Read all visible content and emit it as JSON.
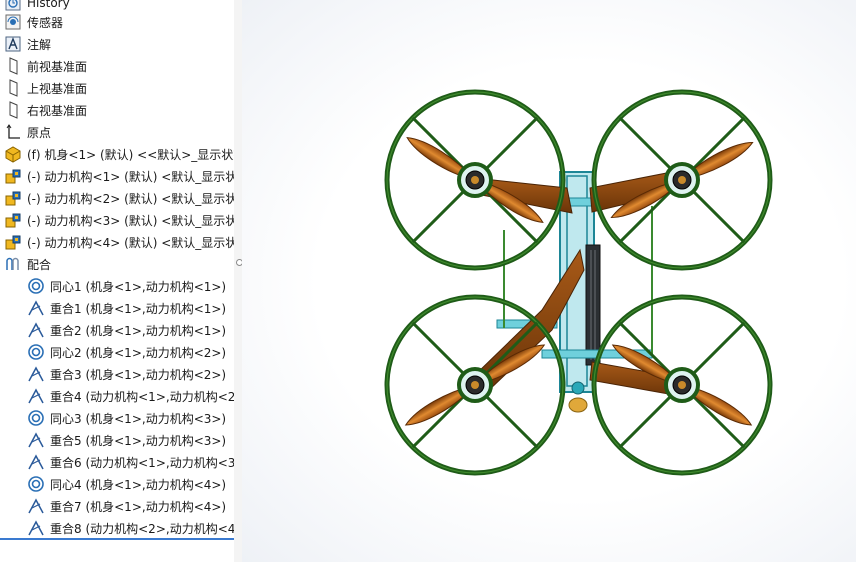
{
  "feature_tree": {
    "items": [
      {
        "label": "History",
        "icon": "history-icon"
      },
      {
        "label": "传感器",
        "icon": "sensor-icon"
      },
      {
        "label": "注解",
        "icon": "annotation-icon"
      },
      {
        "label": "前视基准面",
        "icon": "plane-icon"
      },
      {
        "label": "上视基准面",
        "icon": "plane-icon"
      },
      {
        "label": "右视基准面",
        "icon": "plane-icon"
      },
      {
        "label": "原点",
        "icon": "origin-icon"
      },
      {
        "label": "(f) 机身<1> (默认) <<默认>_显示状态",
        "icon": "part-icon"
      },
      {
        "label": "(-) 动力机构<1> (默认) <默认_显示状",
        "icon": "subassembly-icon"
      },
      {
        "label": "(-) 动力机构<2> (默认) <默认_显示状",
        "icon": "subassembly-icon"
      },
      {
        "label": "(-) 动力机构<3> (默认) <默认_显示状",
        "icon": "subassembly-icon"
      },
      {
        "label": "(-) 动力机构<4> (默认) <默认_显示状",
        "icon": "subassembly-icon"
      },
      {
        "label": "配合",
        "icon": "mates-folder-icon"
      }
    ],
    "mates": [
      {
        "label": "同心1 (机身<1>,动力机构<1>)",
        "icon": "concentric-icon"
      },
      {
        "label": "重合1 (机身<1>,动力机构<1>)",
        "icon": "coincident-icon"
      },
      {
        "label": "重合2 (机身<1>,动力机构<1>)",
        "icon": "coincident-icon"
      },
      {
        "label": "同心2 (机身<1>,动力机构<2>)",
        "icon": "concentric-icon"
      },
      {
        "label": "重合3 (机身<1>,动力机构<2>)",
        "icon": "coincident-icon"
      },
      {
        "label": "重合4 (动力机构<1>,动力机构<2>",
        "icon": "coincident-icon"
      },
      {
        "label": "同心3 (机身<1>,动力机构<3>)",
        "icon": "concentric-icon"
      },
      {
        "label": "重合5 (机身<1>,动力机构<3>)",
        "icon": "coincident-icon"
      },
      {
        "label": "重合6 (动力机构<1>,动力机构<3>",
        "icon": "coincident-icon"
      },
      {
        "label": "同心4 (机身<1>,动力机构<4>)",
        "icon": "concentric-icon"
      },
      {
        "label": "重合7 (机身<1>,动力机构<4>)",
        "icon": "coincident-icon"
      },
      {
        "label": "重合8 (动力机构<2>,动力机构<4>",
        "icon": "coincident-icon"
      }
    ]
  },
  "colors": {
    "guard_ring": "#1f5c18",
    "guard_ring_light": "#3f8a2c",
    "propeller": "#c2691a",
    "arm": "#8a4a12",
    "frame": "#2aa8b8",
    "tree_accent": "#3a7ad0",
    "icon_yellow": "#e8a817",
    "icon_blue": "#2a6fb5"
  }
}
